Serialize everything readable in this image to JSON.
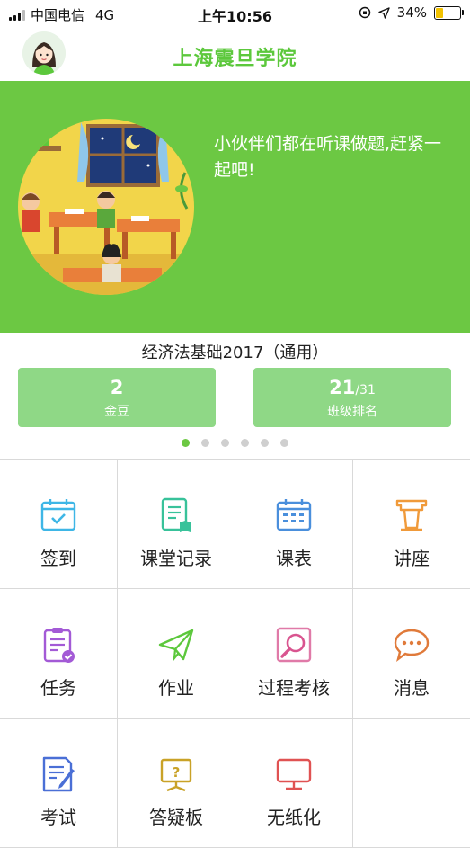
{
  "status_bar": {
    "carrier": "中国电信",
    "network": "4G",
    "time": "上午10:56",
    "battery": "34%",
    "battery_level": 0.34
  },
  "header": {
    "title": "上海震旦学院"
  },
  "banner": {
    "text": "小伙伴们都在听课做题,赶紧一起吧!"
  },
  "course": {
    "name": "经济法基础2017（通用）",
    "coins_value": "2",
    "coins_label": "金豆",
    "rank_value": "21",
    "rank_total": "/31",
    "rank_label": "班级排名"
  },
  "pager": {
    "count": 6,
    "active": 0
  },
  "colors": {
    "brand": "#6cc843",
    "title": "#5cc83c",
    "stat_bg": "#8fd886"
  },
  "menu": [
    {
      "label": "签到",
      "icon": "calendar-check-icon"
    },
    {
      "label": "课堂记录",
      "icon": "notes-book-icon"
    },
    {
      "label": "课表",
      "icon": "timetable-icon"
    },
    {
      "label": "讲座",
      "icon": "podium-icon"
    },
    {
      "label": "任务",
      "icon": "task-clipboard-icon"
    },
    {
      "label": "作业",
      "icon": "paper-plane-icon"
    },
    {
      "label": "过程考核",
      "icon": "magnifier-icon"
    },
    {
      "label": "消息",
      "icon": "chat-bubble-icon"
    },
    {
      "label": "考试",
      "icon": "exam-pen-icon"
    },
    {
      "label": "答疑板",
      "icon": "question-board-icon"
    },
    {
      "label": "无纸化",
      "icon": "monitor-icon"
    }
  ]
}
